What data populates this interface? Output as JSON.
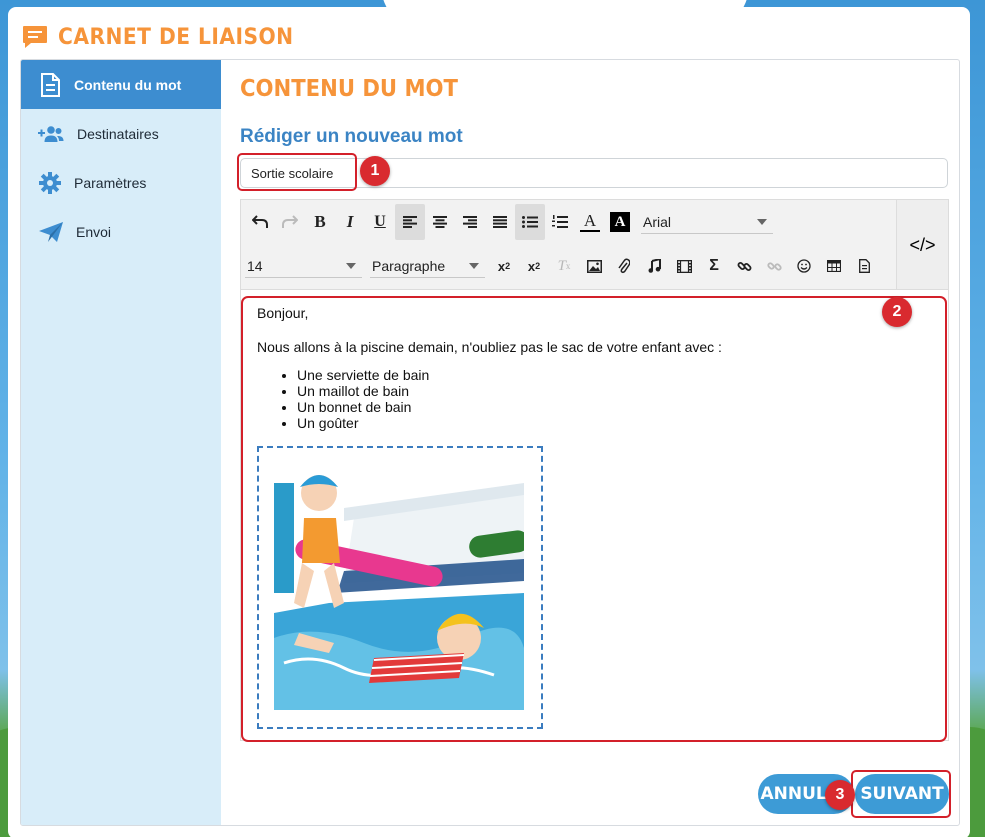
{
  "app": {
    "title": "CARNET DE LIAISON",
    "icon": "message-icon",
    "accent_color": "#f6943a",
    "primary_color": "#3d8dd0"
  },
  "sidebar": {
    "items": [
      {
        "label": "Contenu du mot",
        "icon": "document-icon",
        "active": true
      },
      {
        "label": "Destinataires",
        "icon": "users-icon",
        "active": false
      },
      {
        "label": "Paramètres",
        "icon": "gear-icon",
        "active": false
      },
      {
        "label": "Envoi",
        "icon": "paper-plane-icon",
        "active": false
      }
    ]
  },
  "main": {
    "section_title": "CONTENU DU MOT",
    "subtitle": "Rédiger un nouveau mot",
    "subject": {
      "value": "Sortie scolaire"
    }
  },
  "toolbar": {
    "row1": [
      "undo-icon",
      "redo-icon",
      "bold-icon",
      "italic-icon",
      "underline-icon",
      "align-left-icon",
      "align-center-icon",
      "align-right-icon",
      "align-justify-icon",
      "bullet-list-icon",
      "numbered-list-icon",
      "font-color-icon",
      "background-color-icon"
    ],
    "font_family": "Arial",
    "font_size": "14",
    "block_format": "Paragraphe",
    "row2": [
      "subscript-icon",
      "superscript-icon",
      "clear-format-icon",
      "image-icon",
      "attachment-icon",
      "audio-icon",
      "video-icon",
      "formula-icon",
      "link-icon",
      "unlink-icon",
      "emoji-icon",
      "table-icon",
      "template-icon"
    ],
    "code_view_icon": "code-icon",
    "glyphs": {
      "bold": "B",
      "italic": "I",
      "underline": "U",
      "font_color": "A",
      "background_color": "A",
      "formula": "Σ",
      "subscript": "x",
      "sub_index": "2",
      "superscript": "x",
      "sup_index": "2",
      "clear_format": "T",
      "clear_x": "x",
      "code": "</>"
    }
  },
  "editor": {
    "greeting": "Bonjour,",
    "body": "Nous allons à la piscine demain, n'oubliez pas le sac de votre enfant avec :",
    "items": [
      "Une serviette de bain",
      "Un maillot de bain",
      "Un bonnet de bain",
      "Un goûter"
    ],
    "image_icon": "swimming-illustration"
  },
  "annotations": {
    "one": "1",
    "two": "2",
    "three": "3"
  },
  "footer": {
    "cancel_label": "ANNULER",
    "next_label": "SUIVANT"
  }
}
